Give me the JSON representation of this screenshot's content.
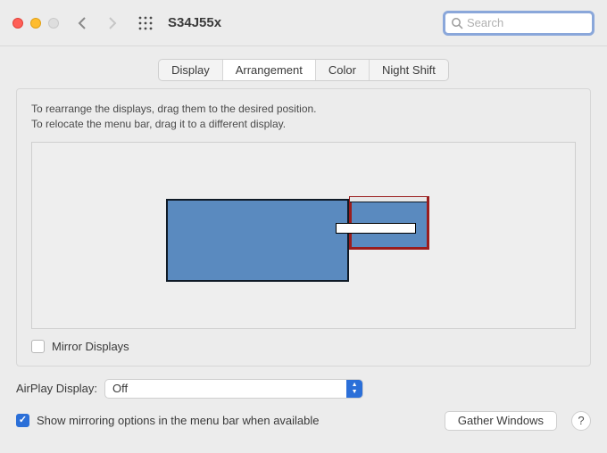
{
  "title": "S34J55x",
  "search_placeholder": "Search",
  "tabs": {
    "display": "Display",
    "arrangement": "Arrangement",
    "color": "Color",
    "night_shift": "Night Shift"
  },
  "instructions": {
    "line1": "To rearrange the displays, drag them to the desired position.",
    "line2": "To relocate the menu bar, drag it to a different display."
  },
  "mirror_label": "Mirror Displays",
  "airplay": {
    "label": "AirPlay Display:",
    "value": "Off"
  },
  "show_mirroring_label": "Show mirroring options in the menu bar when available",
  "gather_windows": "Gather Windows",
  "help": "?"
}
